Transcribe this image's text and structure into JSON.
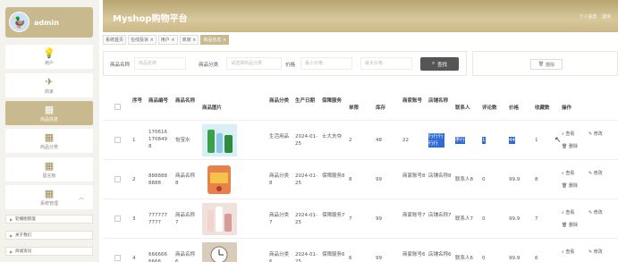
{
  "user": {
    "name": "admin"
  },
  "sidebar": {
    "items": [
      {
        "label": "用户",
        "icon": "light-bulb-icon"
      },
      {
        "label": "商家",
        "icon": "paper-plane-icon"
      },
      {
        "label": "商品信息",
        "icon": "grid-icon",
        "active": true
      },
      {
        "label": "商品分类",
        "icon": "grid-icon"
      },
      {
        "label": "留言板",
        "icon": "grid-icon"
      },
      {
        "label": "系统管理",
        "icon": "grid-icon"
      }
    ],
    "subitems": [
      "轮播图管理",
      "关于我们",
      "商城资讯"
    ]
  },
  "header": {
    "title": "Myshop购物平台",
    "center": "个人信息",
    "logout": "退出"
  },
  "tabs": [
    {
      "label": "系统首页",
      "active": false
    },
    {
      "label": "在线投诉 ×",
      "active": false
    },
    {
      "label": "用户 ×",
      "active": false
    },
    {
      "label": "商家 ×",
      "active": false
    },
    {
      "label": "商品信息 ×",
      "active": true
    }
  ],
  "search": {
    "name_label": "商品名称",
    "name_placeholder": "商品名称",
    "category_label": "商品分类",
    "category_placeholder": "请选择商品分类",
    "price_label": "价格",
    "price_min_placeholder": "最小价格",
    "price_max_placeholder": "最大价格",
    "button": "查找"
  },
  "delete_button": "删除",
  "table": {
    "headers": [
      "序号",
      "商品编号",
      "商品名称",
      "商品图片",
      "商品分类",
      "生产日期",
      "保障服务",
      "单限",
      "库存",
      "商家账号",
      "店铺名称",
      "联系人",
      "评论数",
      "价格",
      "收藏数",
      "操作"
    ],
    "rows": [
      {
        "seq": "1",
        "code": "1706161708498",
        "name": "怡宝水",
        "category": "生活用品",
        "date": "2024-01-25",
        "service": "士大夫夺",
        "limit": "2",
        "stock": "48",
        "merchant": "22",
        "shop": "行行行行行",
        "contact": "李行",
        "comments": "1",
        "price": "44",
        "favs": "1",
        "img": "#d9eef5"
      },
      {
        "seq": "2",
        "code": "8888888888",
        "name": "商品名称8",
        "category": "商品分类8",
        "date": "2024-01-25",
        "service": "保障服务8",
        "limit": "8",
        "stock": "99",
        "merchant": "商家账号8",
        "shop": "店铺名称8",
        "contact": "联系人8",
        "comments": "0",
        "price": "99.9",
        "favs": "8",
        "img": "#e7814a"
      },
      {
        "seq": "3",
        "code": "7777777777",
        "name": "商品名称7",
        "category": "商品分类7",
        "date": "2024-01-25",
        "service": "保障服务7",
        "limit": "7",
        "stock": "99",
        "merchant": "商家账号7",
        "shop": "店铺名称7",
        "contact": "联系人7",
        "comments": "0",
        "price": "99.9",
        "favs": "7",
        "img": "#e8d6cf"
      },
      {
        "seq": "4",
        "code": "6666666666",
        "name": "商品名称6",
        "category": "商品分类6",
        "date": "2024-01-25",
        "service": "保障服务6",
        "limit": "6",
        "stock": "99",
        "merchant": "商家账号6",
        "shop": "店铺名称6",
        "contact": "联系人6",
        "comments": "0",
        "price": "99.9",
        "favs": "6",
        "img": "#cfc3b3"
      }
    ],
    "actions": {
      "view": "查看",
      "edit": "修改",
      "delete": "删除"
    }
  }
}
